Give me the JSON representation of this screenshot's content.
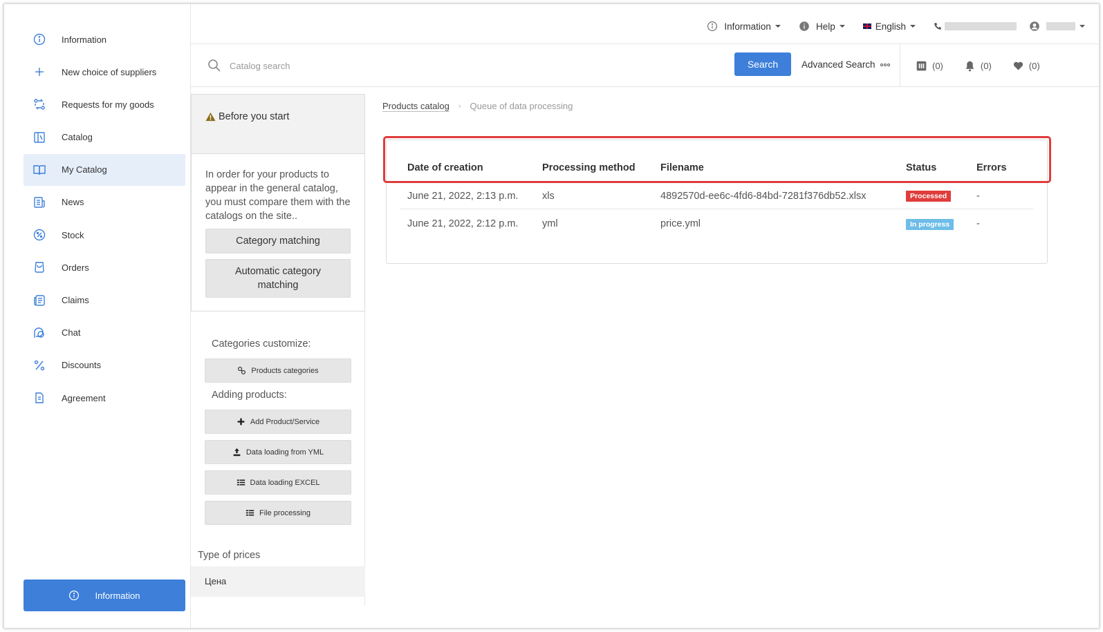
{
  "sidebar": {
    "items": [
      {
        "label": "Information",
        "icon": "info-icon"
      },
      {
        "label": "New choice of suppliers",
        "icon": "plus-icon"
      },
      {
        "label": "Requests for my goods",
        "icon": "exchange-icon"
      },
      {
        "label": "Catalog",
        "icon": "catalog-icon"
      },
      {
        "label": "My Catalog",
        "icon": "book-icon",
        "active": true
      },
      {
        "label": "News",
        "icon": "news-icon"
      },
      {
        "label": "Stock",
        "icon": "percent-circle-icon"
      },
      {
        "label": "Orders",
        "icon": "bag-icon"
      },
      {
        "label": "Claims",
        "icon": "claims-icon"
      },
      {
        "label": "Chat",
        "icon": "chat-icon"
      },
      {
        "label": "Discounts",
        "icon": "percent-icon"
      },
      {
        "label": "Agreement",
        "icon": "document-icon"
      }
    ],
    "bottom_button": "Information"
  },
  "topbar": {
    "information": "Information",
    "help": "Help",
    "language": "English"
  },
  "search": {
    "placeholder": "Catalog search",
    "button": "Search",
    "advanced": "Advanced Search",
    "compare_count": "(0)",
    "notifications_count": "(0)",
    "favorites_count": "(0)"
  },
  "before_start": {
    "title": "Before you start",
    "text": "In order for your products to appear in the general catalog, you must compare them with the catalogs on the site..",
    "category_matching": "Category matching",
    "auto_matching": "Automatic category matching"
  },
  "side_actions": {
    "categories_label": "Categories customize:",
    "products_categories": "Products categories",
    "adding_label": "Adding products:",
    "add_product": "Add Product/Service",
    "yml_loading": "Data loading from YML",
    "excel_loading": "Data loading EXCEL",
    "file_processing": "File processing",
    "type_of_prices": "Type of prices",
    "price_name": "Цена"
  },
  "breadcrumb": {
    "parent": "Products catalog",
    "current": "Queue of data processing"
  },
  "table": {
    "headers": [
      "Date of creation",
      "Processing method",
      "Filename",
      "Status",
      "Errors"
    ],
    "rows": [
      {
        "date": "June 21, 2022, 2:13 p.m.",
        "method": "xls",
        "filename": "4892570d-ee6c-4fd6-84bd-7281f376db52.xlsx",
        "status": "Processed",
        "errors": "-"
      },
      {
        "date": "June 21, 2022, 2:12 p.m.",
        "method": "yml",
        "filename": "price.yml",
        "status": "In progress",
        "errors": "-"
      }
    ]
  },
  "colors": {
    "accent": "#3d7fd9",
    "processed": "#e03c3c",
    "in_progress": "#6dbde8",
    "highlight": "#e03c3c"
  }
}
